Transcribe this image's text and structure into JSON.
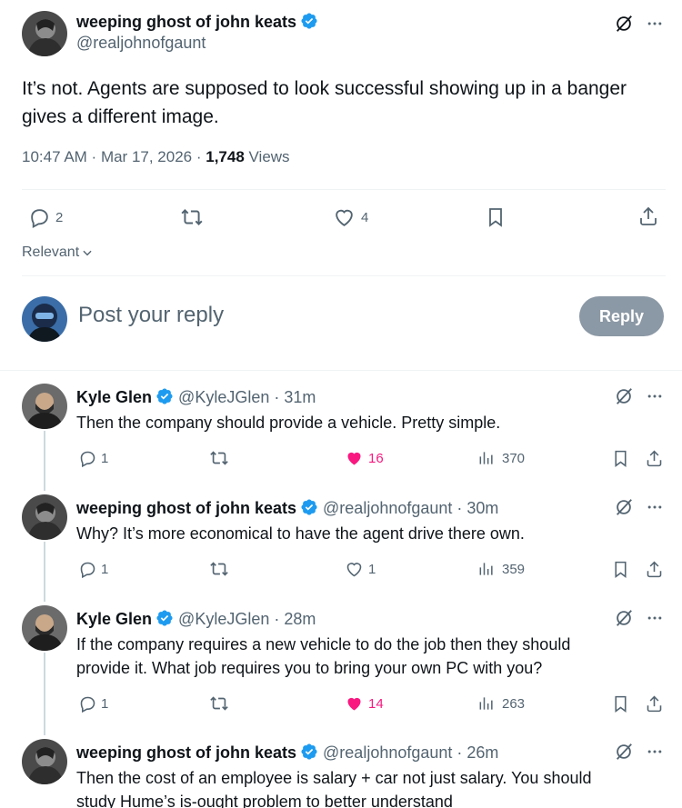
{
  "main_tweet": {
    "author_name": "weeping ghost of john keats",
    "author_handle": "@realjohnofgaunt",
    "text_line1": "It’s not. Agents are supposed to look successful showing up in a banger",
    "text_line2": "gives a different image.",
    "time": "10:47 AM",
    "date": "Mar 17, 2026",
    "views_count": "1,748",
    "views_label": "Views",
    "replies": "2",
    "likes": "4"
  },
  "sort": {
    "label": "Relevant"
  },
  "composer": {
    "placeholder": "Post your reply",
    "reply_button": "Reply"
  },
  "replies": [
    {
      "name": "Kyle Glen",
      "handle": "@KyleJGlen",
      "time": "31m",
      "lines": [
        "Then the company should provide a vehicle. Pretty simple."
      ],
      "replies": "1",
      "likes": "16",
      "liked": true,
      "views": "370"
    },
    {
      "name": "weeping ghost of john keats",
      "handle": "@realjohnofgaunt",
      "time": "30m",
      "lines": [
        "Why? It’s more economical to have the agent drive there own."
      ],
      "replies": "1",
      "likes": "1",
      "liked": false,
      "views": "359"
    },
    {
      "name": "Kyle Glen",
      "handle": "@KyleJGlen",
      "time": "28m",
      "lines": [
        "If the company requires a new vehicle to do the job then they should",
        "provide it. What job requires you to bring your own PC with you?"
      ],
      "replies": "1",
      "likes": "14",
      "liked": true,
      "views": "263"
    },
    {
      "name": "weeping ghost of john keats",
      "handle": "@realjohnofgaunt",
      "time": "26m",
      "lines": [
        "Then the cost of an employee is salary + car not just salary.  You should",
        "study Hume’s is-ought problem to better understand"
      ],
      "replies": "",
      "likes": "",
      "liked": false,
      "views": ""
    }
  ],
  "colors": {
    "accent": "#1d9bf0",
    "like_active": "#f91880",
    "text_secondary": "#536471",
    "reply_button_bg": "#8b98a5"
  },
  "icons": [
    "grok-icon",
    "more-icon",
    "reply-icon",
    "retweet-icon",
    "like-icon",
    "bookmark-icon",
    "share-icon",
    "views-icon",
    "verified-icon",
    "chevron-down-icon"
  ]
}
